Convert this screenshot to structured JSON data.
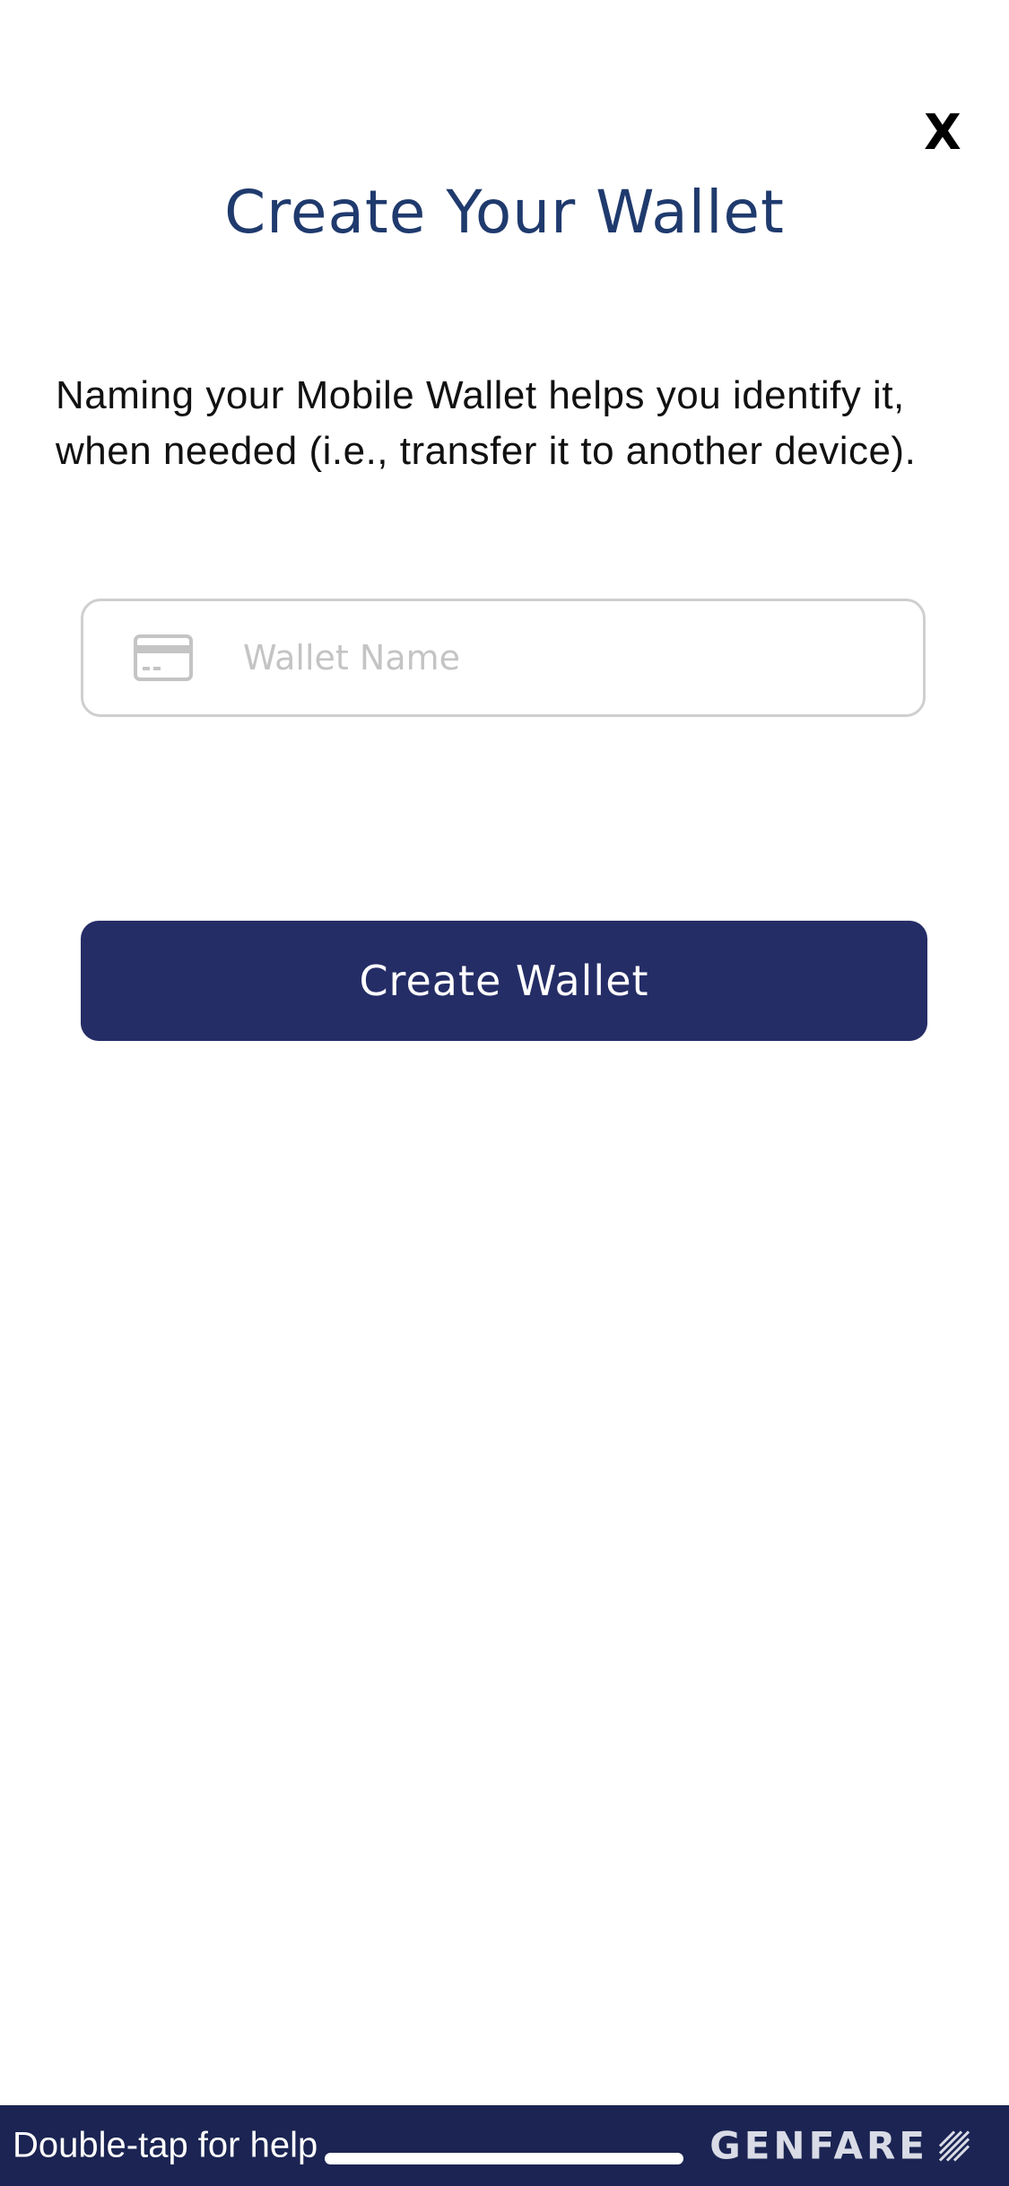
{
  "header": {
    "close_label": "X",
    "title": "Create Your Wallet"
  },
  "main": {
    "description": "Naming your Mobile Wallet helps you identify it, when needed (i.e., transfer it to another device).",
    "wallet_name": {
      "value": "",
      "placeholder": "Wallet Name",
      "icon": "credit-card-icon"
    },
    "create_button_label": "Create Wallet"
  },
  "footer": {
    "help_text": "Double-tap for help",
    "brand_name": "GENFARE",
    "brand_icon": "genfare-logo-icon"
  },
  "colors": {
    "title": "#1f3a6d",
    "primary_button": "#252d66",
    "footer_bar": "#1b2452",
    "input_border": "#cfcfcf",
    "placeholder": "#c4c4c4"
  }
}
